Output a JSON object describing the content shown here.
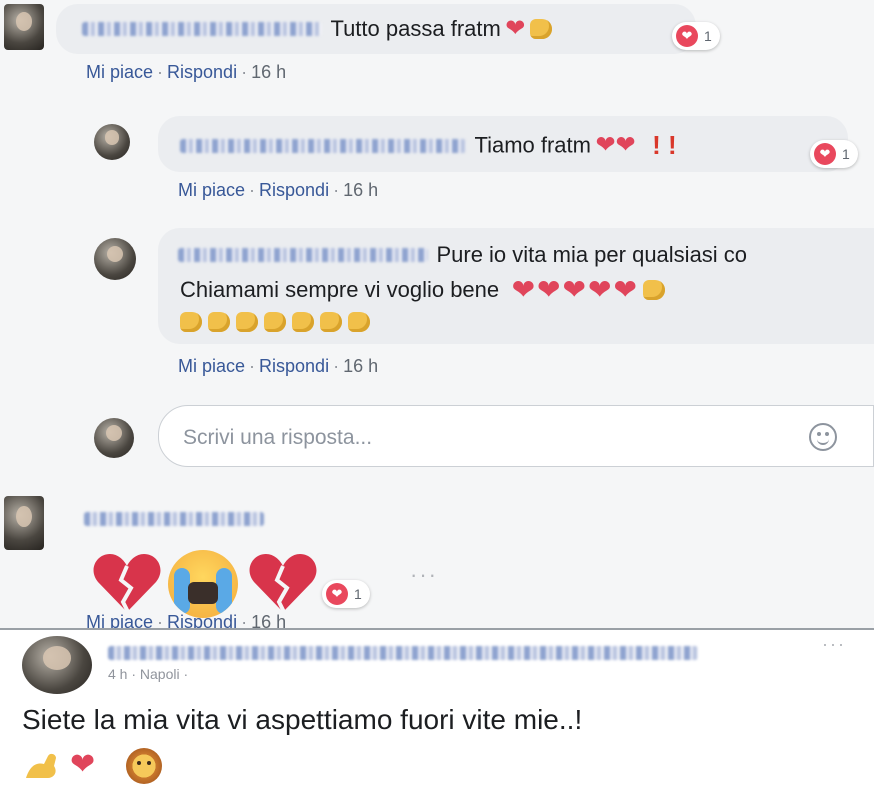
{
  "comments": [
    {
      "text": "Tutto passa fratm",
      "emoji_suffix": "❤",
      "reaction_count": "1",
      "actions": {
        "like": "Mi piace",
        "reply": "Rispondi",
        "time": "16 h"
      },
      "replies": [
        {
          "text": "Tiamo fratm",
          "emoji_suffix": "❤❤",
          "exclaim": "! !",
          "reaction_count": "1",
          "actions": {
            "like": "Mi piace",
            "reply": "Rispondi",
            "time": "16 h"
          }
        },
        {
          "line1": "Pure io vita mia per qualsiasi co",
          "line2": "Chiamami sempre vi voglio bene",
          "hearts": "❤❤❤❤❤",
          "actions": {
            "like": "Mi piace",
            "reply": "Rispondi",
            "time": "16 h"
          }
        }
      ],
      "reply_input": {
        "placeholder": "Scrivi una risposta..."
      }
    },
    {
      "reaction_count": "1",
      "dots": "···",
      "actions": {
        "like": "Mi piace",
        "reply": "Rispondi",
        "time": "16 h"
      }
    }
  ],
  "post": {
    "meta": "4 h · Napoli ·",
    "text": "Siete la mia vita vi aspettiamo fuori vite mie..!",
    "more_dots": "···",
    "heart": "❤"
  },
  "separator": "·",
  "colors": {
    "link": "#385898",
    "heart": "#e0455b",
    "bubble": "#ebedf0",
    "reaction": "#e9485d"
  },
  "icons": [
    "love-reaction-icon",
    "smiley-icon",
    "broken-heart-icon",
    "crying-face-icon",
    "pointing-hand-icon",
    "flexed-arm-icon",
    "lion-face-icon"
  ]
}
